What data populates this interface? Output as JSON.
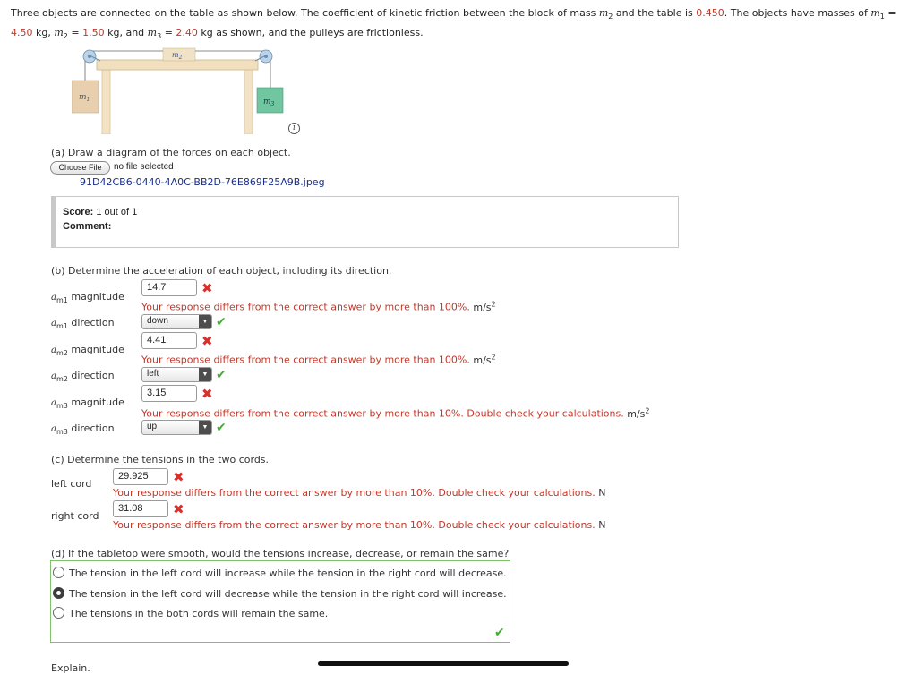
{
  "problem": {
    "intro": "Three objects are connected on the table as shown below. The coefficient of kinetic friction between the block of mass",
    "m2_sym": "m",
    "m2_sub": "2",
    "mid1": "and the table is",
    "mu": "0.450",
    "mid2": ". The objects have masses of",
    "m1_sym": "m",
    "m1_sub": "1",
    "eq1": "=",
    "m1_val": "4.50",
    "unit_kg1": "kg,",
    "m2b_sym": "m",
    "m2b_sub": "2",
    "eq2": "=",
    "m2_val": "1.50",
    "unit_kg2": "kg, and",
    "m3_sym": "m",
    "m3_sub": "3",
    "eq3": "=",
    "m3_val": "2.40",
    "tail": "kg as shown, and the pulleys are frictionless."
  },
  "figure": {
    "m1_label": "m",
    "m1_sub": "1",
    "m2_label": "m",
    "m2_sub": "2",
    "m3_label": "m",
    "m3_sub": "3",
    "info_glyph": "i"
  },
  "part_a": {
    "prompt": "(a) Draw a diagram of the forces on each object.",
    "choose_file": "Choose File",
    "no_file": "no file selected",
    "filename": "91D42CB6-0440-4A0C-BB2D-76E869F25A9B.jpeg",
    "score_label": "Score:",
    "score_value": "1 out of 1",
    "comment_label": "Comment:"
  },
  "part_b": {
    "prompt": "(b) Determine the acceleration of each object, including its direction.",
    "rows": [
      {
        "var": "a",
        "sub": "m1",
        "label": "magnitude",
        "value": "14.7",
        "feedback": "Your response differs from the correct answer by more than 100%.",
        "unit": "m/s",
        "unit_exp": "2"
      },
      {
        "var": "a",
        "sub": "m1",
        "label": "direction",
        "selected": "down"
      },
      {
        "var": "a",
        "sub": "m2",
        "label": "magnitude",
        "value": "4.41",
        "feedback": "Your response differs from the correct answer by more than 100%.",
        "unit": "m/s",
        "unit_exp": "2"
      },
      {
        "var": "a",
        "sub": "m2",
        "label": "direction",
        "selected": "left"
      },
      {
        "var": "a",
        "sub": "m3",
        "label": "magnitude",
        "value": "3.15",
        "feedback": "Your response differs from the correct answer by more than 10%. Double check your calculations.",
        "unit": "m/s",
        "unit_exp": "2"
      },
      {
        "var": "a",
        "sub": "m3",
        "label": "direction",
        "selected": "up"
      }
    ]
  },
  "part_c": {
    "prompt": "(c) Determine the tensions in the two cords.",
    "rows": [
      {
        "label": "left cord",
        "value": "29.925",
        "feedback": "Your response differs from the correct answer by more than 10%. Double check your calculations.",
        "unit": "N"
      },
      {
        "label": "right cord",
        "value": "31.08",
        "feedback": "Your response differs from the correct answer by more than 10%. Double check your calculations.",
        "unit": "N"
      }
    ]
  },
  "part_d": {
    "prompt": "(d) If the tabletop were smooth, would the tensions increase, decrease, or remain the same?",
    "options": [
      "The tension in the left cord will increase while the tension in the right cord will decrease.",
      "The tension in the left cord will decrease while the tension in the right cord will increase.",
      "The tensions in the both cords will remain the same."
    ],
    "selected_index": 1,
    "explain_label": "Explain."
  },
  "colors": {
    "wrong": "#d9302c",
    "correct": "#4aa83c",
    "value_red": "#c0392b",
    "block_m1": "#e8cfae",
    "block_m3": "#6fc6a0",
    "table": "#f1dfbd"
  },
  "icons": {
    "wrong": "x-mark-icon",
    "correct": "check-mark-icon",
    "dropdown": "chevron-down-icon",
    "info": "info-icon"
  }
}
